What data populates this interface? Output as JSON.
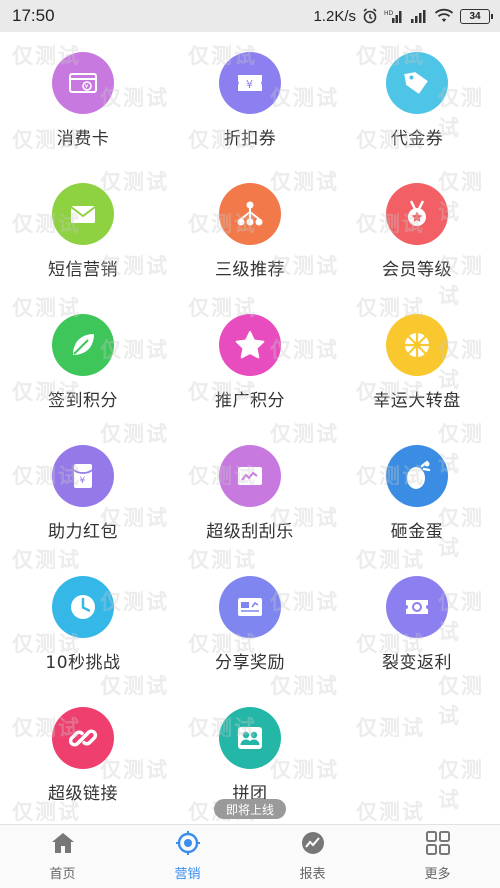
{
  "status_bar": {
    "time": "17:50",
    "speed": "1.2K/s",
    "battery": "34"
  },
  "grid_items": [
    {
      "label": "消费卡",
      "color": "#c879e0",
      "icon": "card-icon"
    },
    {
      "label": "折扣券",
      "color": "#8c7ff0",
      "icon": "coupon-icon"
    },
    {
      "label": "代金券",
      "color": "#4ec4e6",
      "icon": "tag-icon"
    },
    {
      "label": "短信营销",
      "color": "#8ed141",
      "icon": "envelope-icon"
    },
    {
      "label": "三级推荐",
      "color": "#f27a4a",
      "icon": "hierarchy-icon"
    },
    {
      "label": "会员等级",
      "color": "#f25f65",
      "icon": "medal-icon"
    },
    {
      "label": "签到积分",
      "color": "#3ec65a",
      "icon": "leaf-icon"
    },
    {
      "label": "推广积分",
      "color": "#e84dc0",
      "icon": "star-icon"
    },
    {
      "label": "幸运大转盘",
      "color": "#f9c82e",
      "icon": "wheel-icon"
    },
    {
      "label": "助力红包",
      "color": "#9679e9",
      "icon": "red-packet-icon"
    },
    {
      "label": "超级刮刮乐",
      "color": "#c879e0",
      "icon": "scratch-card-icon"
    },
    {
      "label": "砸金蛋",
      "color": "#3a8de2",
      "icon": "egg-icon"
    },
    {
      "label": "10秒挑战",
      "color": "#35b7e8",
      "icon": "clock-icon"
    },
    {
      "label": "分享奖励",
      "color": "#7f86f0",
      "icon": "share-icon"
    },
    {
      "label": "裂变返利",
      "color": "#8c7ff0",
      "icon": "ticket-icon"
    },
    {
      "label": "超级链接",
      "color": "#ef3f6f",
      "icon": "link-icon"
    },
    {
      "label": "拼团",
      "color": "#24b7a8",
      "icon": "group-icon"
    }
  ],
  "coming_soon_badge": "即将上线",
  "watermark_text": "仅测试",
  "tab_bar": [
    {
      "label": "首页",
      "icon": "home-icon"
    },
    {
      "label": "营销",
      "icon": "target-icon",
      "active": true
    },
    {
      "label": "报表",
      "icon": "chart-icon"
    },
    {
      "label": "更多",
      "icon": "grid-icon"
    }
  ]
}
